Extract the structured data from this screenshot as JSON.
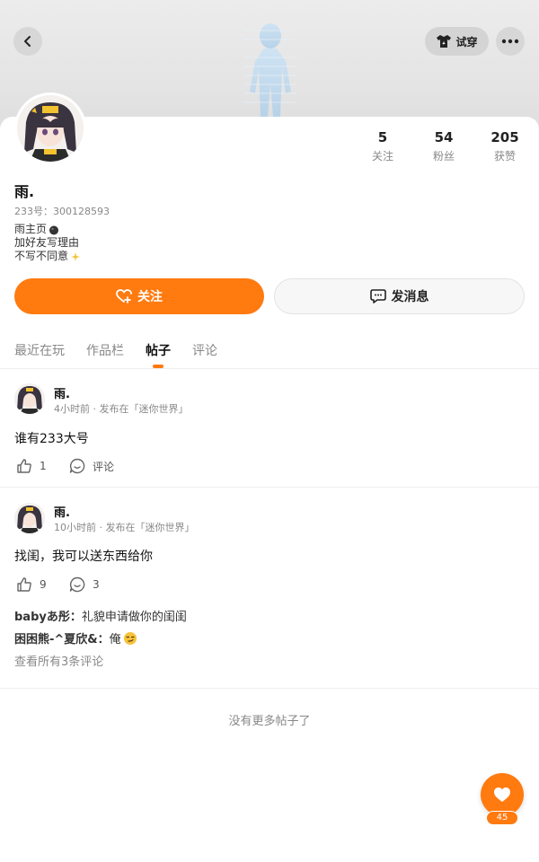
{
  "header": {
    "back_icon": "chevron-left-icon",
    "tryon_label": "试穿",
    "tryon_icon": "shirt-icon",
    "more_icon": "more-horizontal-icon"
  },
  "profile": {
    "username": "雨.",
    "id_line": "233号：300128593",
    "bio": [
      "雨主页",
      "加好友写理由",
      "不写不同意"
    ],
    "stats": [
      {
        "value": "5",
        "label": "关注"
      },
      {
        "value": "54",
        "label": "粉丝"
      },
      {
        "value": "205",
        "label": "获赞"
      }
    ]
  },
  "actions": {
    "follow_label": "关注",
    "message_label": "发消息"
  },
  "tabs": [
    "最近在玩",
    "作品栏",
    "帖子",
    "评论"
  ],
  "active_tab": "帖子",
  "posts": [
    {
      "author": "雨.",
      "meta": "4小时前 · 发布在「迷你世界」",
      "text": "谁有233大号",
      "likes": "1",
      "comment_label": "评论"
    },
    {
      "author": "雨.",
      "meta": "10小时前 · 发布在「迷你世界」",
      "text": "找闺，我可以送东西给你",
      "likes": "9",
      "comments": "3",
      "comment_preview": [
        {
          "user": "babyあ彤：",
          "text": "礼貌申请做你的闺闺"
        },
        {
          "user": "困困熊-^夏欣&：",
          "text": "俺"
        }
      ],
      "view_all": "查看所有3条评论"
    }
  ],
  "footer": {
    "no_more": "没有更多帖子了",
    "fab_count": "45"
  },
  "colors": {
    "accent": "#ff7a0f"
  }
}
